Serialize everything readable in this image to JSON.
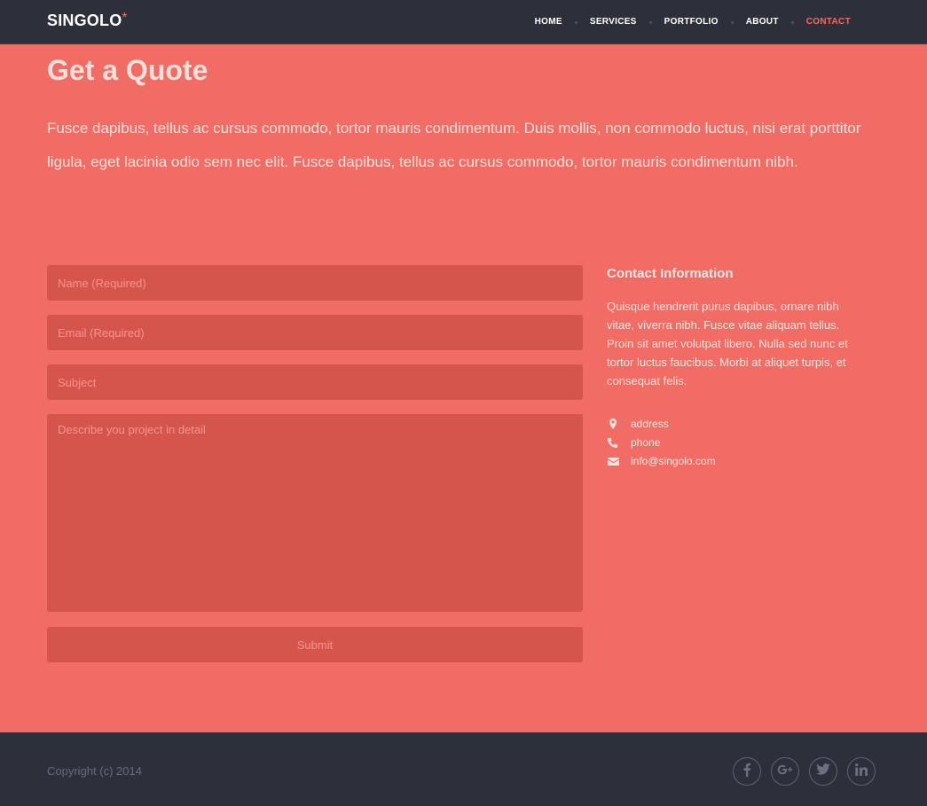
{
  "header": {
    "logo_text": "SINGOLO",
    "logo_mark": "*",
    "nav": [
      {
        "label": "HOME"
      },
      {
        "label": "SERVICES"
      },
      {
        "label": "PORTFOLIO"
      },
      {
        "label": "ABOUT"
      },
      {
        "label": "CONTACT",
        "active": true
      }
    ]
  },
  "main": {
    "title": "Get a Quote",
    "intro": "Fusce dapibus, tellus ac cursus commodo, tortor mauris condimentum. Duis mollis, non commodo luctus, nisi erat porttitor ligula, eget lacinia odio sem nec elit. Fusce dapibus, tellus ac cursus commodo, tortor mauris condimentum nibh.",
    "form": {
      "name_placeholder": "Name (Required)",
      "name_value": "",
      "email_placeholder": "Email (Required)",
      "email_value": "",
      "subject_placeholder": "Subject",
      "subject_value": "",
      "message_placeholder": "Describe you project in detail",
      "message_value": "",
      "submit_label": "Submit"
    },
    "contact": {
      "title": "Contact Information",
      "description": "Quisque hendrerit purus dapibus, ornare nibh vitae, viverra nibh. Fusce vitae aliquam tellus. Proin sit amet volutpat libero. Nulla sed nunc et tortor luctus faucibus. Morbi at aliquet turpis, et consequat felis.",
      "items": [
        {
          "icon": "map-marker-icon",
          "text": "address"
        },
        {
          "icon": "phone-icon",
          "text": "phone"
        },
        {
          "icon": "envelope-icon",
          "text": "info@singolo.com"
        }
      ]
    }
  },
  "footer": {
    "copyright": "Copyright (c) 2014",
    "social": [
      {
        "icon": "facebook-icon"
      },
      {
        "icon": "google-plus-icon"
      },
      {
        "icon": "twitter-icon"
      },
      {
        "icon": "linkedin-icon"
      }
    ]
  },
  "colors": {
    "dark": "#2d303a",
    "accent": "#f06c64",
    "field": "#d5554d"
  }
}
